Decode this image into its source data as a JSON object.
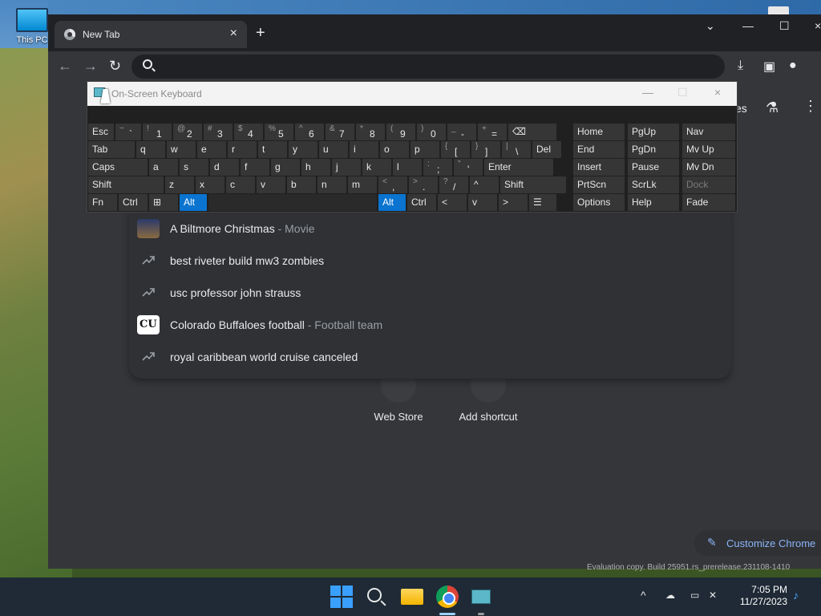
{
  "desktop": {
    "icon_label": "This PC"
  },
  "browser": {
    "tab_title": "New Tab",
    "search_placeholder": "",
    "ntp_partial_text": "es"
  },
  "keyboard": {
    "title": "On-Screen Keyboard",
    "rows": [
      [
        "Esc",
        "~ `",
        "! 1",
        "@ 2",
        "# 3",
        "$ 4",
        "% 5",
        "^ 6",
        "& 7",
        "* 8",
        "( 9",
        ") 0",
        "_ -",
        "+ =",
        "⌫"
      ],
      [
        "Tab",
        "q",
        "w",
        "e",
        "r",
        "t",
        "y",
        "u",
        "i",
        "o",
        "p",
        "{ [",
        "} ]",
        "| \\",
        "Del"
      ],
      [
        "Caps",
        "a",
        "s",
        "d",
        "f",
        "g",
        "h",
        "j",
        "k",
        "l",
        ": ;",
        "\" '",
        "Enter"
      ],
      [
        "Shift",
        "z",
        "x",
        "c",
        "v",
        "b",
        "n",
        "m",
        "< ,",
        "> .",
        "? /",
        "^",
        "Shift"
      ],
      [
        "Fn",
        "Ctrl",
        "⊞",
        "Alt",
        "",
        "Alt",
        "Ctrl",
        "<",
        "v",
        ">",
        "☰"
      ]
    ],
    "nav_keys": [
      [
        "Home",
        "PgUp",
        "Nav"
      ],
      [
        "End",
        "PgDn",
        "Mv Up"
      ],
      [
        "Insert",
        "Pause",
        "Mv Dn"
      ],
      [
        "PrtScn",
        "ScrLk",
        "Dock"
      ],
      [
        "Options",
        "Help",
        "Fade"
      ]
    ]
  },
  "suggestions": [
    {
      "text": "A Biltmore Christmas",
      "sub": " - Movie",
      "icon": "movie-thumbnail"
    },
    {
      "text": "best riveter build mw3 zombies",
      "sub": "",
      "icon": "trending-icon"
    },
    {
      "text": "usc professor john strauss",
      "sub": "",
      "icon": "trending-icon"
    },
    {
      "text": "Colorado Buffaloes football",
      "sub": " - Football team",
      "icon": "cu-logo"
    },
    {
      "text": "royal caribbean world cruise canceled",
      "sub": "",
      "icon": "trending-icon"
    }
  ],
  "shortcuts": [
    {
      "label": "Web Store"
    },
    {
      "label": "Add shortcut"
    }
  ],
  "customize_label": "Customize Chrome",
  "evaluation_text": "Evaluation copy. Build 25951.rs_prerelease.231108-1410",
  "taskbar": {
    "time": "7:05 PM",
    "date": "11/27/2023"
  },
  "colors": {
    "accent": "#0a74d0",
    "link": "#8ab4f8"
  }
}
